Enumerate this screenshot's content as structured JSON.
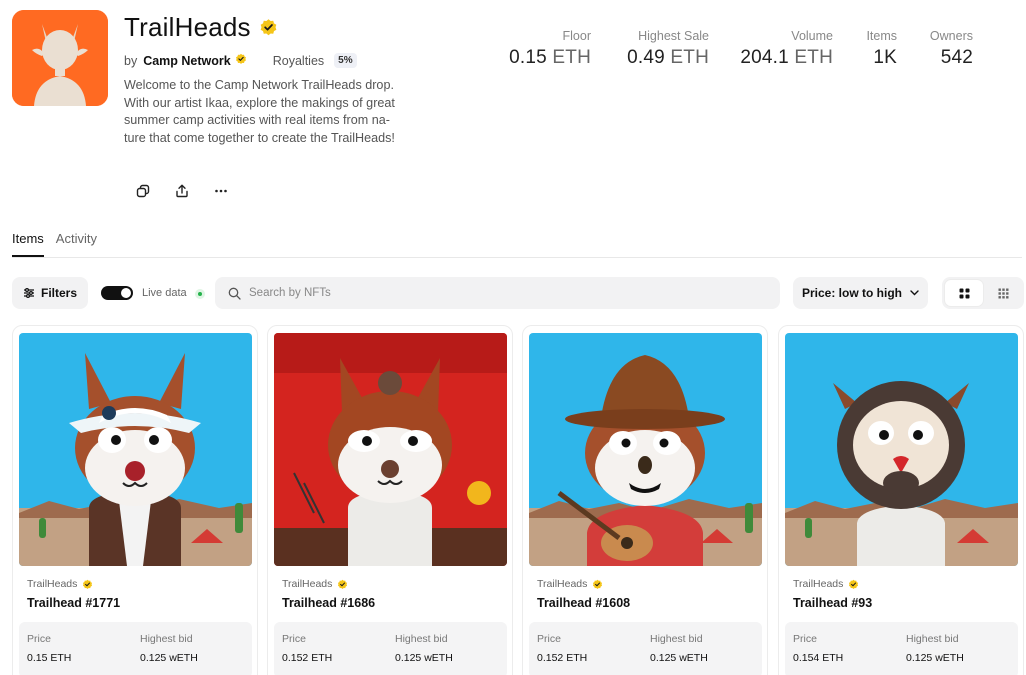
{
  "collection": {
    "name": "TrailHeads",
    "by_prefix": "by",
    "creator": "Camp Network",
    "royalties_label": "Royalties",
    "royalties_value": "5%",
    "description": "Welcome to the Camp Network TrailHeads drop. With our artist Ikaa, explore the makings of great summer camp activities with real items from na-ture that come together to create the TrailHeads!",
    "avatar_color": "#ff6a22"
  },
  "actions": [
    "copy-icon",
    "share-icon",
    "more-icon"
  ],
  "stats": [
    {
      "label": "Floor",
      "value": "0.15",
      "unit": "ETH"
    },
    {
      "label": "Highest Sale",
      "value": "0.49",
      "unit": "ETH"
    },
    {
      "label": "Volume",
      "value": "204.1",
      "unit": "ETH"
    },
    {
      "label": "Items",
      "value": "1K",
      "unit": ""
    },
    {
      "label": "Owners",
      "value": "542",
      "unit": ""
    }
  ],
  "tabs": {
    "items": "Items",
    "activity": "Activity"
  },
  "toolbar": {
    "filters": "Filters",
    "live_label": "Live data",
    "live_on": true,
    "search_placeholder": "Search by NFTs",
    "sort": "Price: low to high"
  },
  "items": [
    {
      "collection": "TrailHeads",
      "name": "Trailhead #1771",
      "price_label": "Price",
      "price": "0.15 ETH",
      "bid_label": "Highest bid",
      "bid": "0.125 wETH"
    },
    {
      "collection": "TrailHeads",
      "name": "Trailhead #1686",
      "price_label": "Price",
      "price": "0.152 ETH",
      "bid_label": "Highest bid",
      "bid": "0.125 wETH"
    },
    {
      "collection": "TrailHeads",
      "name": "Trailhead #1608",
      "price_label": "Price",
      "price": "0.152 ETH",
      "bid_label": "Highest bid",
      "bid": "0.125 wETH"
    },
    {
      "collection": "TrailHeads",
      "name": "Trailhead #93",
      "price_label": "Price",
      "price": "0.154 ETH",
      "bid_label": "Highest bid",
      "bid": "0.125 wETH"
    }
  ],
  "colors": {
    "verified": "#f5c518",
    "accent": "#111111",
    "live": "#26b24c"
  }
}
